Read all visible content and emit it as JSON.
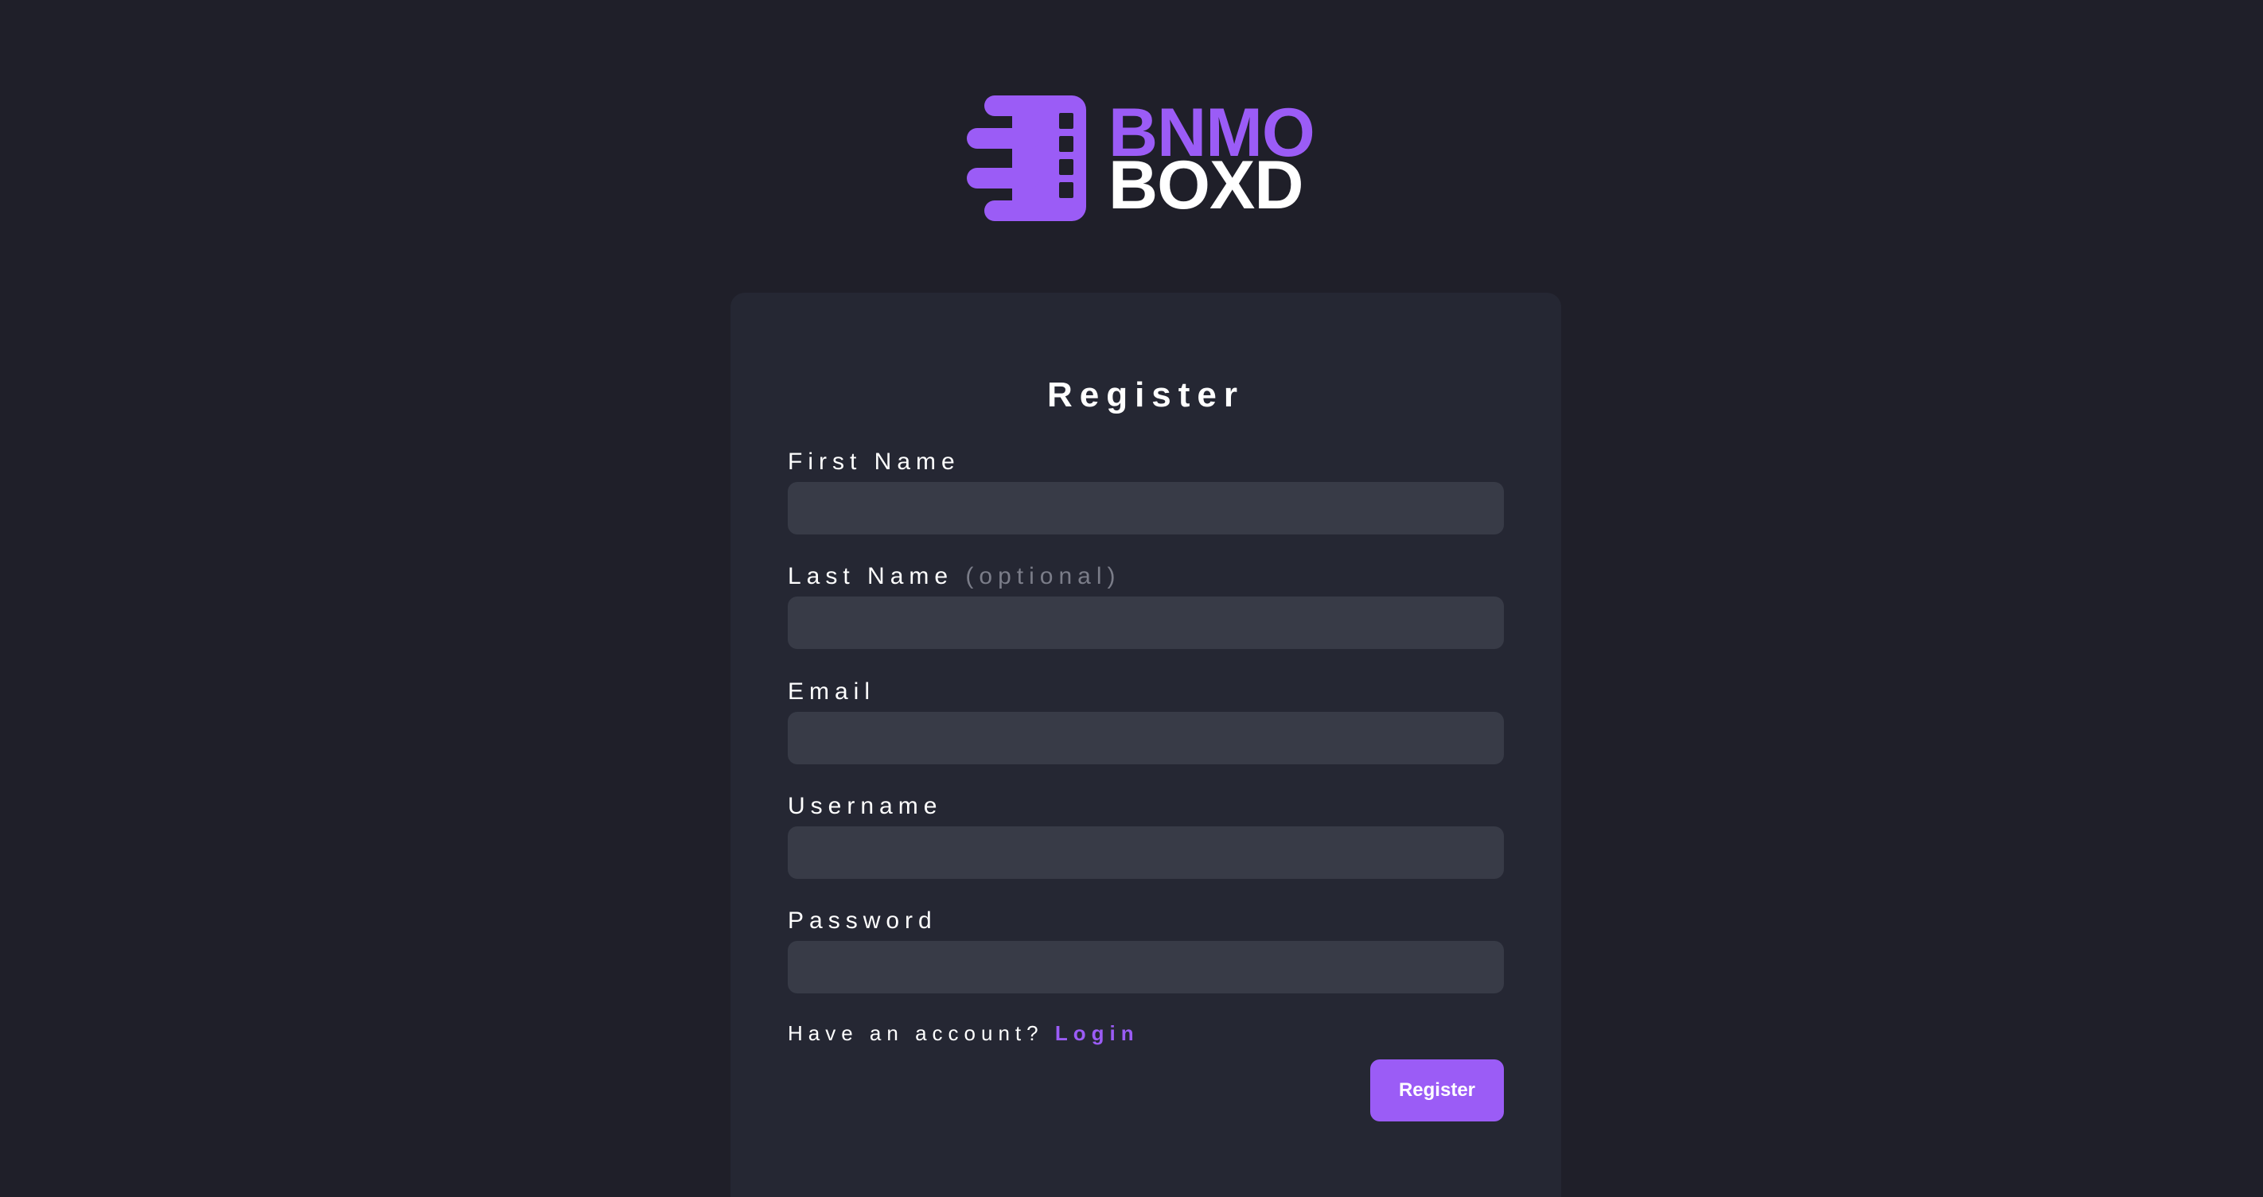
{
  "brand": {
    "name_top": "BNMO",
    "name_bottom": "BOXD",
    "accent_color": "#9b5cf6",
    "mark_icon": "film-reel-icon"
  },
  "form": {
    "title": "Register",
    "fields": [
      {
        "label": "First Name",
        "optional_note": "",
        "value": "",
        "placeholder": ""
      },
      {
        "label": "Last Name",
        "optional_note": "(optional)",
        "value": "",
        "placeholder": ""
      },
      {
        "label": "Email",
        "optional_note": "",
        "value": "",
        "placeholder": ""
      },
      {
        "label": "Username",
        "optional_note": "",
        "value": "",
        "placeholder": ""
      },
      {
        "label": "Password",
        "optional_note": "",
        "value": "",
        "placeholder": ""
      }
    ],
    "account_prompt": "Have an account?",
    "login_link": "Login",
    "submit_label": "Register"
  },
  "colors": {
    "background": "#1f1f29",
    "card": "#252733",
    "input": "#383b47",
    "muted_text": "#7b7d89"
  }
}
